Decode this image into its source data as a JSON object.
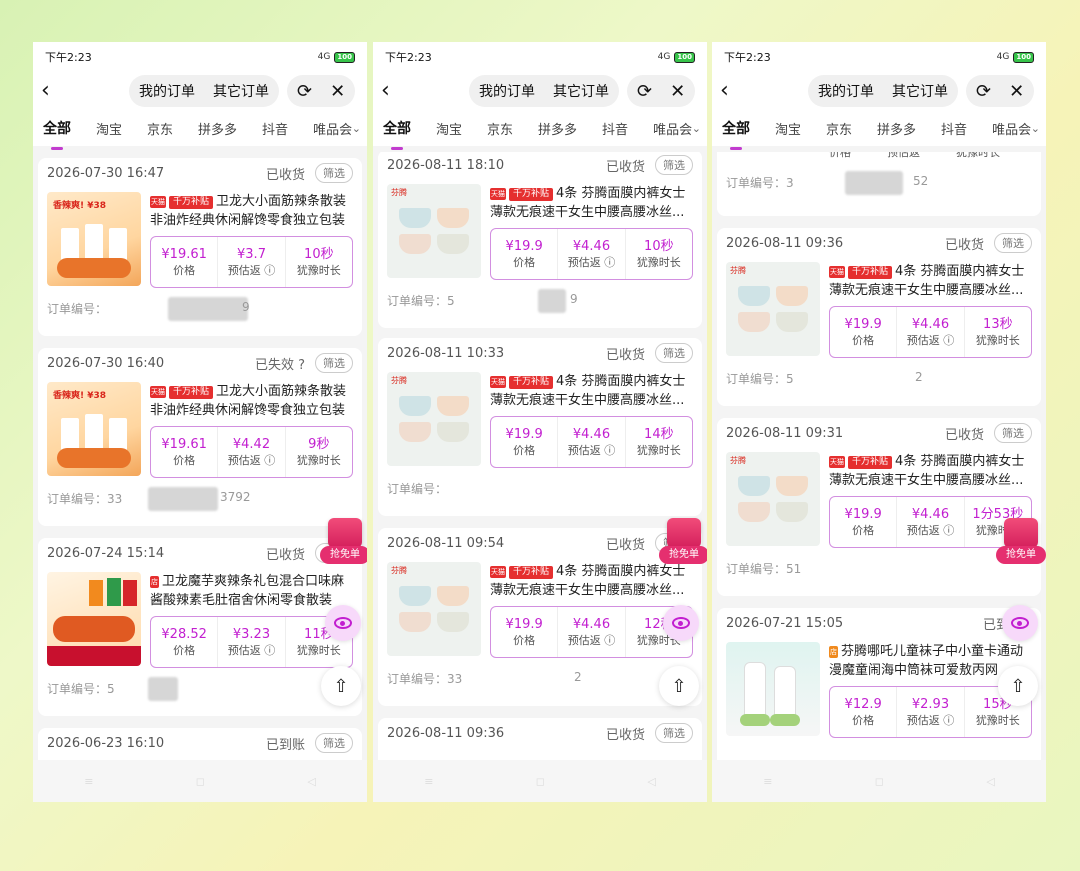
{
  "common": {
    "time": "下午2:23",
    "battery": "100",
    "signal": "4G",
    "seg_mine": "我的订单",
    "seg_other": "其它订单",
    "tabs": [
      "全部",
      "淘宝",
      "京东",
      "拼多多",
      "抖音",
      "唯品会"
    ],
    "filter": "筛选",
    "price_label": "价格",
    "rebate_label": "预估返",
    "hesitate_label": "犹豫时长",
    "order_prefix": "订单编号：",
    "badge_subsidy": "千万补贴",
    "gift_label": "抢免单",
    "accent_color": "#c21fd0"
  },
  "screens": [
    {
      "orders": [
        {
          "date": "2026-07-30 16:47",
          "status": "已收货",
          "title": "卫龙大小面筋辣条散装非油炸经典休闲解馋零食独立包装",
          "price": "¥19.61",
          "rebate": "¥3.7",
          "hesitate": "10秒",
          "order_no": "订单编号：",
          "order_tail": "9",
          "thumb_tag": "香辣爽! ¥38"
        },
        {
          "date": "2026-07-30 16:40",
          "status": "已失效",
          "title": "卫龙大小面筋辣条散装非油炸经典休闲解馋零食独立包装",
          "price": "¥19.61",
          "rebate": "¥4.42",
          "hesitate": "9秒",
          "order_no": "订单编号：33",
          "order_tail": "3792",
          "thumb_tag": "香辣爽! ¥38"
        },
        {
          "date": "2026-07-24 15:14",
          "status": "已收货",
          "title": "卫龙魔芋爽辣条礼包混合口味麻酱酸辣素毛肚宿舍休闲零食散装",
          "price": "¥28.52",
          "rebate": "¥3.23",
          "hesitate": "11秒",
          "order_no": "订单编号：5",
          "order_tail": ""
        },
        {
          "date": "2026-06-23 16:10",
          "status": "已到账"
        }
      ]
    },
    {
      "orders": [
        {
          "date": "2026-08-11 18:10",
          "status": "已收货",
          "title": "4条 芬腾面膜内裤女士薄款无痕速干女生中腰高腰冰丝...",
          "price": "¥19.9",
          "rebate": "¥4.46",
          "hesitate": "10秒",
          "order_no": "订单编号：5",
          "order_tail": "9",
          "thumb_logo": "芬腾"
        },
        {
          "date": "2026-08-11 10:33",
          "status": "已收货",
          "title": "4条 芬腾面膜内裤女士薄款无痕速干女生中腰高腰冰丝...",
          "price": "¥19.9",
          "rebate": "¥4.46",
          "hesitate": "14秒",
          "order_no": "订单编号：",
          "order_tail": "",
          "thumb_logo": "芬腾"
        },
        {
          "date": "2026-08-11 09:54",
          "status": "已收货",
          "title": "4条 芬腾面膜内裤女士薄款无痕速干女生中腰高腰冰丝...",
          "price": "¥19.9",
          "rebate": "¥4.46",
          "hesitate": "12秒",
          "order_no": "订单编号：33",
          "order_tail": "2",
          "thumb_logo": "芬腾"
        },
        {
          "date": "2026-08-11 09:36",
          "status": "已收货"
        }
      ]
    },
    {
      "orders": [
        {
          "partial_top": true,
          "price_label": "价格",
          "rebate_label": "预估返",
          "hesitate_label": "犹豫时长",
          "order_no": "订单编号：3",
          "order_tail": "52"
        },
        {
          "date": "2026-08-11 09:36",
          "status": "已收货",
          "title": "4条 芬腾面膜内裤女士薄款无痕速干女生中腰高腰冰丝...",
          "price": "¥19.9",
          "rebate": "¥4.46",
          "hesitate": "13秒",
          "order_no": "订单编号：5",
          "order_tail": "2",
          "thumb_logo": "芬腾"
        },
        {
          "date": "2026-08-11 09:31",
          "status": "已收货",
          "title": "4条 芬腾面膜内裤女士薄款无痕速干女生中腰高腰冰丝...",
          "price": "¥19.9",
          "rebate": "¥4.46",
          "hesitate": "1分53秒",
          "order_no": "订单编号：51",
          "order_tail": "",
          "thumb_logo": "芬腾"
        },
        {
          "date": "2026-07-21 15:05",
          "status": "已到账",
          "title": "芬腾哪吒儿童袜子中小童卡通动漫魔童闹海中筒袜可爱敖丙网",
          "price": "¥12.9",
          "rebate": "¥2.93",
          "hesitate": "15秒",
          "order_no": "",
          "order_tail": ""
        }
      ]
    }
  ]
}
